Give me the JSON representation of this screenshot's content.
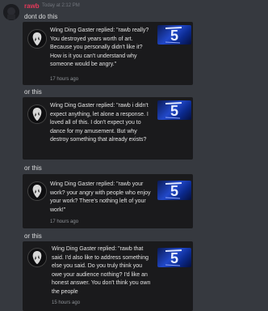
{
  "message": {
    "author": "rawb",
    "timestamp": "Today at 2:12 PM",
    "intro": "dont do this",
    "separator": "or this"
  },
  "notifications": [
    {
      "text": "Wing Ding Gaster replied: \"rawb really? You destroyed years worth of art. Because you personally didn't like it? How is it you can't understand why someone would be angry.\"",
      "age": "17 hours ago"
    },
    {
      "text": "Wing Ding Gaster replied: \"rawb i didn't expect anything, let alone a response. I loved all of this. I don't expect you to dance for my amusement. But why destroy something that already exists?",
      "age": ""
    },
    {
      "text": "Wing Ding Gaster replied: \"rawb your work? your angry with people who enjoy your work? There's nothing left of your work!\"",
      "age": "17 hours ago"
    },
    {
      "text": "Wing Ding Gaster replied: \"rawb that said. I'd also like to address something else you said. Do you truly think you owe your audience nothing? I'd like an honest answer. You don't think you own the people",
      "age": "15 hours ago"
    }
  ]
}
